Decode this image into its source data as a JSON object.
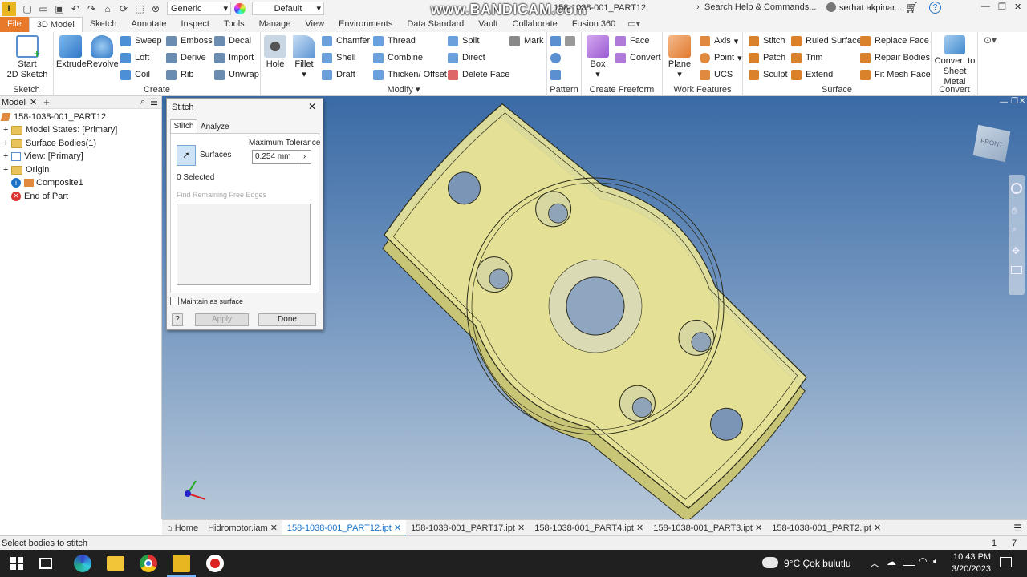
{
  "titlebar": {
    "app_icon_letter": "I",
    "appearance_select": "Generic",
    "material_select": "Default",
    "file_title": "158-1038-001_PART12",
    "watermark": "www.BANDICAM.com",
    "search_placeholder": "Search Help & Commands...",
    "user": "serhat.akpinar...",
    "help_glyph": "?"
  },
  "ribbon_tabs": [
    "File",
    "3D Model",
    "Sketch",
    "Annotate",
    "Inspect",
    "Tools",
    "Manage",
    "View",
    "Environments",
    "Data Standard",
    "Vault",
    "Collaborate",
    "Fusion 360"
  ],
  "ribbon": {
    "sketch_panel": {
      "label": "Sketch",
      "start_sketch": "Start\n2D Sketch"
    },
    "create_panel": {
      "label": "Create",
      "extrude": "Extrude",
      "revolve": "Revolve",
      "sweep": "Sweep",
      "loft": "Loft",
      "coil": "Coil",
      "emboss": "Emboss",
      "derive": "Derive",
      "rib": "Rib",
      "decal": "Decal",
      "import": "Import",
      "unwrap": "Unwrap"
    },
    "modify_panel": {
      "label": "Modify",
      "hole": "Hole",
      "fillet": "Fillet",
      "chamfer": "Chamfer",
      "shell": "Shell",
      "draft": "Draft",
      "thread": "Thread",
      "combine": "Combine",
      "thicken": "Thicken/ Offset",
      "split": "Split",
      "direct": "Direct",
      "delete_face": "Delete Face",
      "mark": "Mark"
    },
    "pattern_panel": {
      "label": "Pattern"
    },
    "freeform_panel": {
      "label": "Create Freeform",
      "box": "Box",
      "face": "Face",
      "convert": "Convert"
    },
    "work_panel": {
      "label": "Work Features",
      "plane": "Plane",
      "axis": "Axis",
      "point": "Point",
      "ucs": "UCS"
    },
    "surface_panel": {
      "label": "Surface",
      "stitch": "Stitch",
      "patch": "Patch",
      "sculpt": "Sculpt",
      "ruled": "Ruled Surface",
      "trim": "Trim",
      "extend": "Extend",
      "replace": "Replace Face",
      "repair": "Repair Bodies",
      "fitmesh": "Fit Mesh Face"
    },
    "convert_panel": {
      "label": "Convert",
      "sheet_metal": "Convert to\nSheet Metal"
    }
  },
  "browser": {
    "tab": "Model",
    "add": "+",
    "root": "158-1038-001_PART12",
    "items": [
      "Model States: [Primary]",
      "Surface Bodies(1)",
      "View: [Primary]",
      "Origin",
      "Composite1",
      "End of Part"
    ]
  },
  "dialog": {
    "title": "Stitch",
    "tab_stitch": "Stitch",
    "tab_analyze": "Analyze",
    "surfaces_label": "Surfaces",
    "tolerance_label": "Maximum Tolerance",
    "tolerance_value": "0.254 mm",
    "selected": "0 Selected",
    "find_edges": "Find Remaining Free Edges",
    "maintain": "Maintain as surface",
    "apply": "Apply",
    "done": "Done",
    "help": "?"
  },
  "viewcube_label": "FRONT",
  "doc_tabs": [
    "Home",
    "Hidromotor.iam",
    "158-1038-001_PART12.ipt",
    "158-1038-001_PART17.ipt",
    "158-1038-001_PART4.ipt",
    "158-1038-001_PART3.ipt",
    "158-1038-001_PART2.ipt"
  ],
  "status": {
    "message": "Select bodies to stitch",
    "count1": "1",
    "count2": "7"
  },
  "taskbar": {
    "weather": "9°C  Çok bulutlu",
    "time": "10:43 PM",
    "date": "3/20/2023"
  },
  "colors": {
    "accent": "#1a73c8",
    "file_tab": "#e8792a",
    "part_fill": "#e6e39a",
    "part_edge": "#2b2b1a"
  }
}
